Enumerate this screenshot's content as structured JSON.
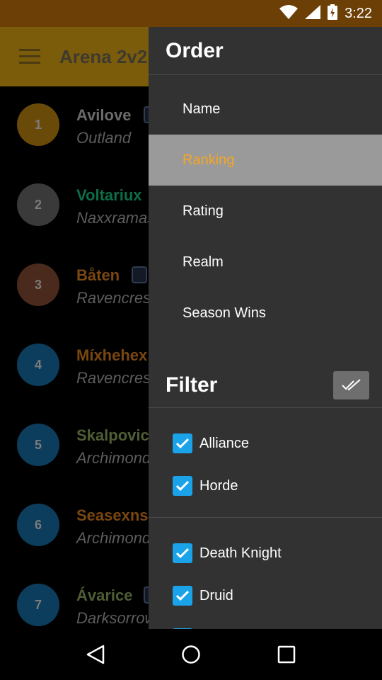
{
  "status_bar": {
    "time": "3:22"
  },
  "app_bar": {
    "title": "Arena 2v2"
  },
  "list": [
    {
      "rank": "1",
      "name": "Avilove",
      "realm": "Outland",
      "name_color": "#6b6b6b",
      "circle_color": "#6a4a08",
      "badge": true
    },
    {
      "rank": "2",
      "name": "Voltariux",
      "realm": "Naxxramas",
      "name_color": "#0c6e47",
      "circle_color": "#3a3a3a",
      "badge": false
    },
    {
      "rank": "3",
      "name": "Båten",
      "realm": "Ravencrest",
      "name_color": "#7a4710",
      "circle_color": "#4a2a1c",
      "badge": true
    },
    {
      "rank": "4",
      "name": "Míxhehex",
      "realm": "Ravencrest",
      "name_color": "#7a4710",
      "circle_color": "#0c3d5c",
      "badge": false
    },
    {
      "rank": "5",
      "name": "Skalpovic",
      "realm": "Archimonde",
      "name_color": "#4f5e35",
      "circle_color": "#0c3d5c",
      "badge": false
    },
    {
      "rank": "6",
      "name": "Seasexns",
      "realm": "Archimonde",
      "name_color": "#7a4710",
      "circle_color": "#0c3d5c",
      "badge": false
    },
    {
      "rank": "7",
      "name": "Ávarice",
      "realm": "Darksorrow",
      "name_color": "#4f5e35",
      "circle_color": "#0c3d5c",
      "badge": true
    }
  ],
  "drawer": {
    "order_title": "Order",
    "order_items": [
      {
        "label": "Name",
        "selected": false
      },
      {
        "label": "Ranking",
        "selected": true
      },
      {
        "label": "Rating",
        "selected": false
      },
      {
        "label": "Realm",
        "selected": false
      },
      {
        "label": "Season Wins",
        "selected": false
      }
    ],
    "filter_title": "Filter",
    "faction_filters": [
      {
        "label": "Alliance",
        "checked": true
      },
      {
        "label": "Horde",
        "checked": true
      }
    ],
    "class_filters": [
      {
        "label": "Death Knight",
        "checked": true
      },
      {
        "label": "Druid",
        "checked": true
      },
      {
        "label": "",
        "checked": true
      }
    ]
  },
  "colors": {
    "accent_selected_text": "#f5a623",
    "checkbox": "#1aa3e8",
    "drawer_bg": "#323232"
  }
}
